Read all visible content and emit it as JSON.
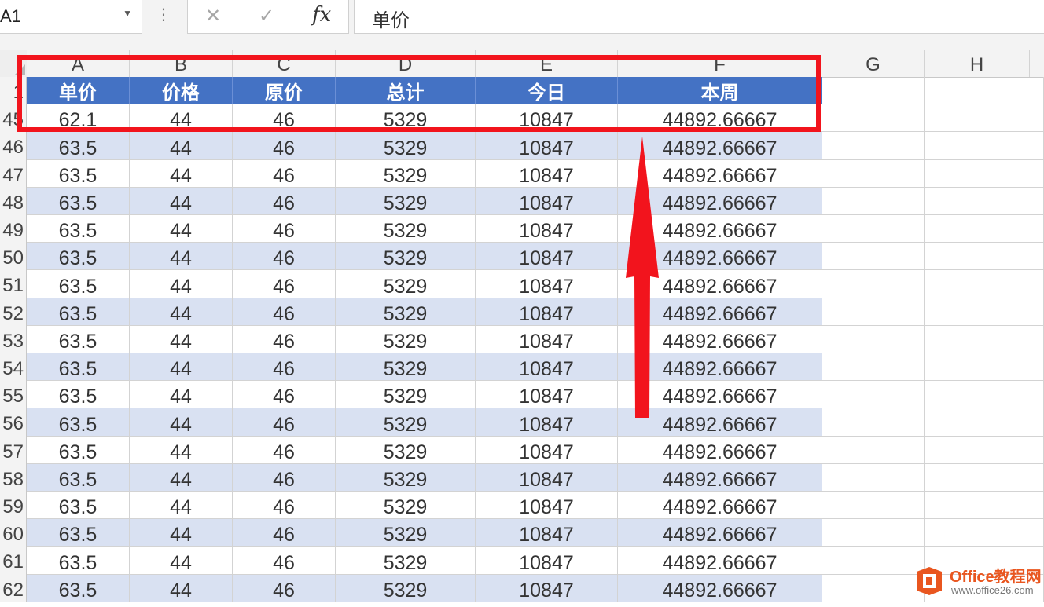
{
  "formula_bar": {
    "name_box": "A1",
    "cancel_icon": "✕",
    "enter_icon": "✓",
    "fx_label": "fx",
    "value": "单价"
  },
  "columns": [
    "A",
    "B",
    "C",
    "D",
    "E",
    "F",
    "G",
    "H"
  ],
  "header_row": {
    "row_number": "1",
    "cells": [
      "单价",
      "价格",
      "原价",
      "总计",
      "今日",
      "本周"
    ]
  },
  "data_rows": [
    {
      "row": "45",
      "cells": [
        "62.1",
        "44",
        "46",
        "5329",
        "10847",
        "44892.66667"
      ]
    },
    {
      "row": "46",
      "cells": [
        "63.5",
        "44",
        "46",
        "5329",
        "10847",
        "44892.66667"
      ]
    },
    {
      "row": "47",
      "cells": [
        "63.5",
        "44",
        "46",
        "5329",
        "10847",
        "44892.66667"
      ]
    },
    {
      "row": "48",
      "cells": [
        "63.5",
        "44",
        "46",
        "5329",
        "10847",
        "44892.66667"
      ]
    },
    {
      "row": "49",
      "cells": [
        "63.5",
        "44",
        "46",
        "5329",
        "10847",
        "44892.66667"
      ]
    },
    {
      "row": "50",
      "cells": [
        "63.5",
        "44",
        "46",
        "5329",
        "10847",
        "44892.66667"
      ]
    },
    {
      "row": "51",
      "cells": [
        "63.5",
        "44",
        "46",
        "5329",
        "10847",
        "44892.66667"
      ]
    },
    {
      "row": "52",
      "cells": [
        "63.5",
        "44",
        "46",
        "5329",
        "10847",
        "44892.66667"
      ]
    },
    {
      "row": "53",
      "cells": [
        "63.5",
        "44",
        "46",
        "5329",
        "10847",
        "44892.66667"
      ]
    },
    {
      "row": "54",
      "cells": [
        "63.5",
        "44",
        "46",
        "5329",
        "10847",
        "44892.66667"
      ]
    },
    {
      "row": "55",
      "cells": [
        "63.5",
        "44",
        "46",
        "5329",
        "10847",
        "44892.66667"
      ]
    },
    {
      "row": "56",
      "cells": [
        "63.5",
        "44",
        "46",
        "5329",
        "10847",
        "44892.66667"
      ]
    },
    {
      "row": "57",
      "cells": [
        "63.5",
        "44",
        "46",
        "5329",
        "10847",
        "44892.66667"
      ]
    },
    {
      "row": "58",
      "cells": [
        "63.5",
        "44",
        "46",
        "5329",
        "10847",
        "44892.66667"
      ]
    },
    {
      "row": "59",
      "cells": [
        "63.5",
        "44",
        "46",
        "5329",
        "10847",
        "44892.66667"
      ]
    },
    {
      "row": "60",
      "cells": [
        "63.5",
        "44",
        "46",
        "5329",
        "10847",
        "44892.66667"
      ]
    },
    {
      "row": "61",
      "cells": [
        "63.5",
        "44",
        "46",
        "5329",
        "10847",
        "44892.66667"
      ]
    },
    {
      "row": "62",
      "cells": [
        "63.5",
        "44",
        "46",
        "5329",
        "10847",
        "44892.66667"
      ]
    }
  ],
  "watermark": {
    "title": "Office教程网",
    "url": "www.office26.com"
  },
  "colors": {
    "header_fill": "#4472c4",
    "band_fill": "#d9e1f2",
    "annotation_red": "#f2141d"
  }
}
